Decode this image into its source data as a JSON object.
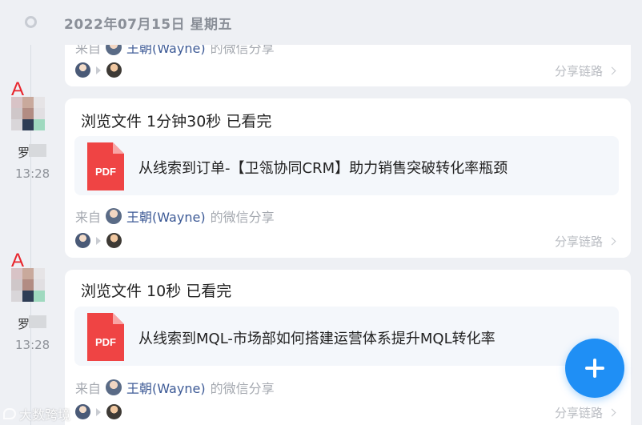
{
  "date_header": {
    "text": "2022年07月15日 星期五"
  },
  "top_partial_card": {
    "from_prefix": "来自",
    "from_name": "王朝(Wayne)",
    "from_suffix": "的微信分享",
    "share_link_label": "分享链路"
  },
  "entries": [
    {
      "visitor_mark": "A",
      "visitor_name": "罗",
      "time": "13:28",
      "title": "浏览文件 1分钟30秒 已看完",
      "file_type": "PDF",
      "file_name": "从线索到订单-【卫瓴协同CRM】助力销售突破转化率瓶颈",
      "from_prefix": "来自",
      "from_name": "王朝(Wayne)",
      "from_suffix": "的微信分享",
      "share_link_label": "分享链路"
    },
    {
      "visitor_mark": "A",
      "visitor_name": "罗",
      "time": "13:28",
      "title": "浏览文件 10秒 已看完",
      "file_type": "PDF",
      "file_name": "从线索到MQL-市场部如何搭建运营体系提升MQL转化率",
      "from_prefix": "来自",
      "from_name": "王朝(Wayne)",
      "from_suffix": "的微信分享",
      "share_link_label": "分享链路"
    }
  ],
  "fab": {
    "icon": "plus-icon"
  },
  "watermark": {
    "text": "大数跨境"
  },
  "colors": {
    "accent": "#1f8ff5",
    "pdf_red": "#ef4444",
    "link_name": "#3d5a96",
    "visitor_mark": "#e8242c",
    "background": "#eef0f4"
  }
}
